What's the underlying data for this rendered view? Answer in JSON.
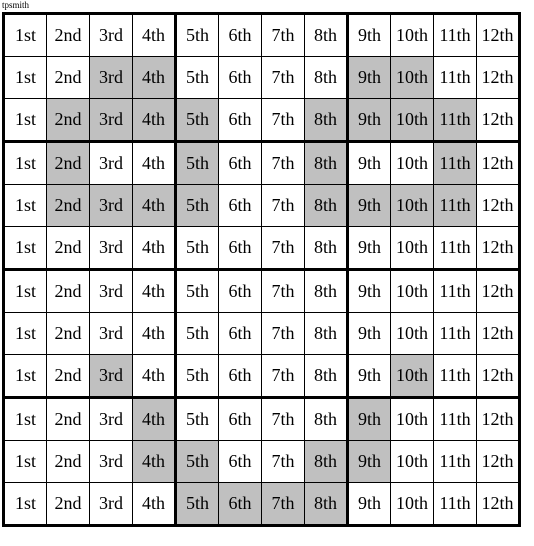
{
  "caption": "tpsmith",
  "grid": {
    "rows": 12,
    "cols": 12,
    "column_labels": [
      "1st",
      "2nd",
      "3rd",
      "4th",
      "5th",
      "6th",
      "7th",
      "8th",
      "9th",
      "10th",
      "11th",
      "12th"
    ],
    "colors": {
      "cell_background": "#ffffff",
      "shaded_background": "#c0c0c0",
      "border": "#000000",
      "text": "#000000"
    },
    "group_separators": {
      "vertical_after_columns": [
        4,
        8
      ],
      "horizontal_after_rows": [
        3,
        6,
        9
      ]
    },
    "cells": [
      [
        "1st",
        "2nd",
        "3rd",
        "4th",
        "5th",
        "6th",
        "7th",
        "8th",
        "9th",
        "10th",
        "11th",
        "12th"
      ],
      [
        "1st",
        "2nd",
        "3rd",
        "4th",
        "5th",
        "6th",
        "7th",
        "8th",
        "9th",
        "10th",
        "11th",
        "12th"
      ],
      [
        "1st",
        "2nd",
        "3rd",
        "4th",
        "5th",
        "6th",
        "7th",
        "8th",
        "9th",
        "10th",
        "11th",
        "12th"
      ],
      [
        "1st",
        "2nd",
        "3rd",
        "4th",
        "5th",
        "6th",
        "7th",
        "8th",
        "9th",
        "10th",
        "11th",
        "12th"
      ],
      [
        "1st",
        "2nd",
        "3rd",
        "4th",
        "5th",
        "6th",
        "7th",
        "8th",
        "9th",
        "10th",
        "11th",
        "12th"
      ],
      [
        "1st",
        "2nd",
        "3rd",
        "4th",
        "5th",
        "6th",
        "7th",
        "8th",
        "9th",
        "10th",
        "11th",
        "12th"
      ],
      [
        "1st",
        "2nd",
        "3rd",
        "4th",
        "5th",
        "6th",
        "7th",
        "8th",
        "9th",
        "10th",
        "11th",
        "12th"
      ],
      [
        "1st",
        "2nd",
        "3rd",
        "4th",
        "5th",
        "6th",
        "7th",
        "8th",
        "9th",
        "10th",
        "11th",
        "12th"
      ],
      [
        "1st",
        "2nd",
        "3rd",
        "4th",
        "5th",
        "6th",
        "7th",
        "8th",
        "9th",
        "10th",
        "11th",
        "12th"
      ],
      [
        "1st",
        "2nd",
        "3rd",
        "4th",
        "5th",
        "6th",
        "7th",
        "8th",
        "9th",
        "10th",
        "11th",
        "12th"
      ],
      [
        "1st",
        "2nd",
        "3rd",
        "4th",
        "5th",
        "6th",
        "7th",
        "8th",
        "9th",
        "10th",
        "11th",
        "12th"
      ],
      [
        "1st",
        "2nd",
        "3rd",
        "4th",
        "5th",
        "6th",
        "7th",
        "8th",
        "9th",
        "10th",
        "11th",
        "12th"
      ]
    ],
    "shaded": [
      [],
      [
        3,
        4,
        9,
        10
      ],
      [
        2,
        3,
        4,
        5,
        8,
        9,
        10,
        11
      ],
      [
        2,
        5,
        8,
        11
      ],
      [
        2,
        3,
        4,
        5,
        8,
        9,
        10,
        11
      ],
      [],
      [],
      [],
      [
        3,
        10
      ],
      [
        4,
        9
      ],
      [
        4,
        5,
        8,
        9
      ],
      [
        5,
        6,
        7,
        8
      ]
    ]
  }
}
